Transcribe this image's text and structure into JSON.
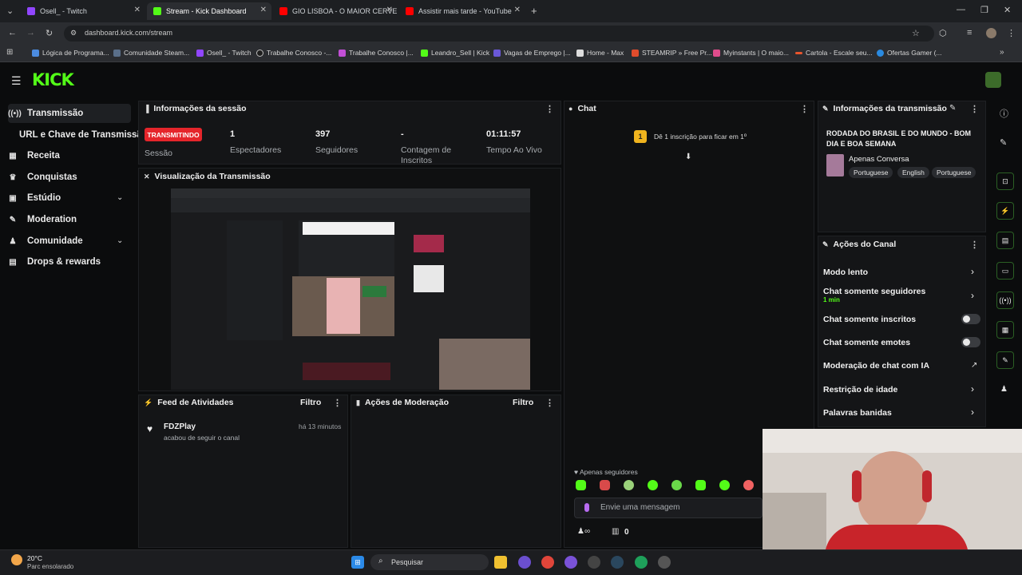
{
  "browser": {
    "tabs": [
      {
        "label": "Osell_ - Twitch",
        "color": "#9146ff"
      },
      {
        "label": "Stream - Kick Dashboard",
        "color": "#53fc18"
      },
      {
        "label": "GIO LISBOA - O MAIOR CERVE",
        "color": "#ff0000"
      },
      {
        "label": "Assistir mais tarde - YouTube",
        "color": "#ff0000"
      }
    ],
    "url": "dashboard.kick.com/stream",
    "bookmarks": [
      "Lógica de Programa...",
      "Comunidade Steam...",
      "Osell_ - Twitch",
      "Trabalhe Conosco -...",
      "Trabalhe Conosco |...",
      "Leandro_Sell | Kick",
      "Vagas de Emprego |...",
      "Home - Max",
      "STEAMRIP » Free Pr...",
      "Myinstants | O maio...",
      "Cartola - Escale seu...",
      "Ofertas Gamer (..."
    ]
  },
  "brand": {
    "logo": "KICK",
    "accent": "#53fc18",
    "live_red": "#e5252b"
  },
  "sidebar": {
    "items": [
      {
        "label": "Transmissão",
        "icon": "broadcast-icon"
      },
      {
        "label": "URL e Chave de Transmissão",
        "icon": ""
      },
      {
        "label": "Receita",
        "icon": "revenue-icon"
      },
      {
        "label": "Conquistas",
        "icon": "trophy-icon"
      },
      {
        "label": "Estúdio",
        "icon": "studio-icon"
      },
      {
        "label": "Moderation",
        "icon": "wrench-icon"
      },
      {
        "label": "Comunidade",
        "icon": "community-icon"
      },
      {
        "label": "Drops & rewards",
        "icon": "gift-icon"
      }
    ]
  },
  "session": {
    "title": "Informações da sessão",
    "status": "TRANSMITINDO",
    "status_label": "Sessão",
    "viewers": "1",
    "viewers_label": "Espectadores",
    "followers": "397",
    "followers_label": "Seguidores",
    "subs": "-",
    "subs_label_1": "Contagem de",
    "subs_label_2": "Inscritos",
    "uptime": "01:11:57",
    "uptime_label": "Tempo Ao Vivo"
  },
  "preview": {
    "title": "Visualização da Transmissão"
  },
  "activity": {
    "title": "Feed de Atividades",
    "filter": "Filtro",
    "items": [
      {
        "user": "FDZPlay",
        "action": "acabou de seguir o canal",
        "time": "há 13 minutos"
      }
    ]
  },
  "modactions": {
    "title": "Ações de Moderação",
    "filter": "Filtro"
  },
  "chat": {
    "title": "Chat",
    "sub_prompt": "Dê 1 inscrição para ficar em 1º",
    "sub_badge": "1",
    "mode": "Apenas seguidores",
    "placeholder": "Envie uma mensagem",
    "count": "0"
  },
  "stream_info": {
    "title": "Informações da transmissão",
    "stream_title": "RODADA DO BRASIL E DO MUNDO - BOM DIA E BOA SEMANA",
    "category": "Apenas Conversa",
    "tags": [
      "Portuguese",
      "English",
      "Portuguese"
    ]
  },
  "channel_actions": {
    "title": "Ações do Canal",
    "items": [
      {
        "label": "Modo lento",
        "type": "chevron"
      },
      {
        "label": "Chat somente seguidores",
        "sub": "1 min",
        "type": "chevron"
      },
      {
        "label": "Chat somente inscritos",
        "type": "toggle"
      },
      {
        "label": "Chat somente emotes",
        "type": "toggle"
      },
      {
        "label": "Moderação de chat com IA",
        "type": "external"
      },
      {
        "label": "Restrição de idade",
        "type": "chevron"
      },
      {
        "label": "Palavras banidas",
        "type": "chevron"
      }
    ]
  },
  "taskbar": {
    "weather_temp": "20°C",
    "weather_desc": "Parc ensolarado",
    "search": "Pesquisar"
  }
}
